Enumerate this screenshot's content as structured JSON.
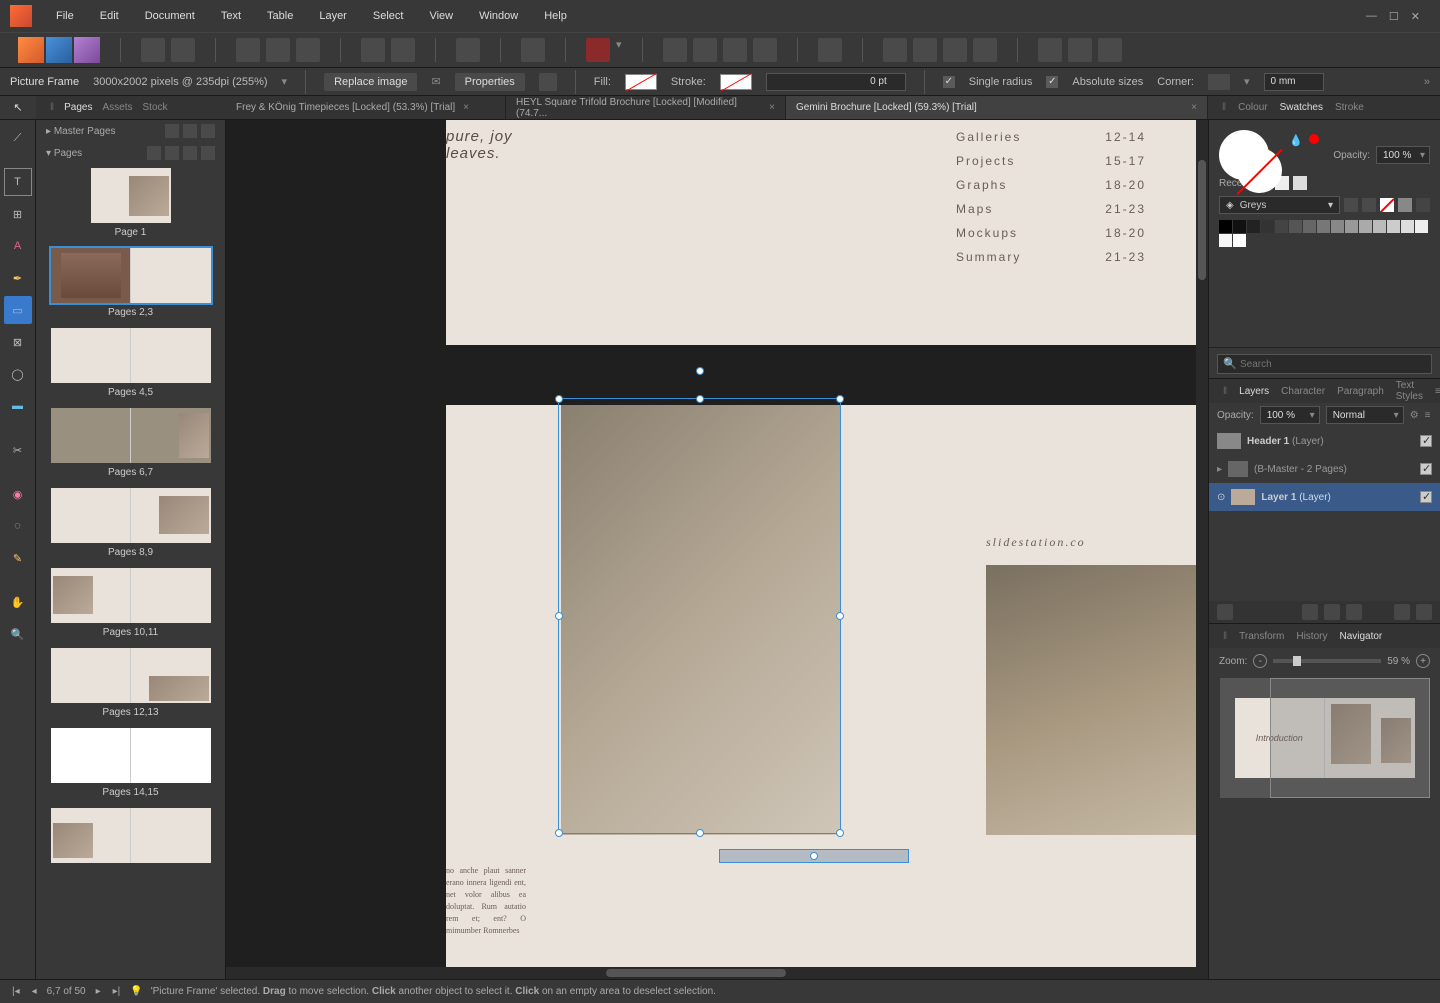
{
  "menu": {
    "items": [
      "File",
      "Edit",
      "Document",
      "Text",
      "Table",
      "Layer",
      "Select",
      "View",
      "Window",
      "Help"
    ]
  },
  "context": {
    "tool": "Picture Frame",
    "dims": "3000x2002 pixels @ 235dpi (255%)",
    "replace": "Replace image",
    "properties": "Properties",
    "fill": "Fill:",
    "stroke": "Stroke:",
    "stroke_val": "0 pt",
    "single_radius": "Single radius",
    "absolute_sizes": "Absolute sizes",
    "corner": "Corner:",
    "corner_val": "0 mm"
  },
  "doc_tabs": [
    {
      "label": "Frey & KÖnig Timepieces [Locked] (53.3%) [Trial]",
      "active": false
    },
    {
      "label": "HEYL Square Trifold Brochure [Locked] [Modified] (74.7...",
      "active": false
    },
    {
      "label": "Gemini Brochure [Locked] (59.3%) [Trial]",
      "active": true
    }
  ],
  "pages_panel": {
    "tabs": [
      "Pages",
      "Assets",
      "Stock"
    ],
    "master": "Master Pages",
    "pages": "Pages",
    "thumbs": [
      {
        "label": "Page 1",
        "single": true,
        "selected": false
      },
      {
        "label": "Pages 2,3",
        "selected": true
      },
      {
        "label": "Pages 4,5"
      },
      {
        "label": "Pages 6,7"
      },
      {
        "label": "Pages 8,9"
      },
      {
        "label": "Pages 10,11"
      },
      {
        "label": "Pages 12,13"
      },
      {
        "label": "Pages 14,15"
      }
    ]
  },
  "right": {
    "color_tabs": [
      "Colour",
      "Swatches",
      "Stroke"
    ],
    "opacity_label": "Opacity:",
    "opacity_val": "100 %",
    "recent": "Recent:",
    "greys": "Greys",
    "search_ph": "Search",
    "layer_tabs": [
      "Layers",
      "Character",
      "Paragraph",
      "Text Styles"
    ],
    "layer_opacity": "Opacity:",
    "layer_opacity_val": "100 %",
    "blend": "Normal",
    "layers": [
      {
        "name": "Header 1",
        "type": "(Layer)"
      },
      {
        "name": "(B-Master - 2 Pages)",
        "type": ""
      },
      {
        "name": "Layer 1",
        "type": "(Layer)",
        "selected": true
      }
    ],
    "nav_tabs": [
      "Transform",
      "History",
      "Navigator"
    ],
    "zoom_label": "Zoom:",
    "zoom_val": "59 %",
    "nav_intro": "Introduction"
  },
  "canvas": {
    "italic_line1": "pure, joy",
    "italic_line2": "leaves.",
    "toc": [
      {
        "k": "Galleries",
        "v": "12-14"
      },
      {
        "k": "Projects",
        "v": "15-17"
      },
      {
        "k": "Graphs",
        "v": "18-20"
      },
      {
        "k": "Maps",
        "v": "21-23"
      },
      {
        "k": "Mockups",
        "v": "18-20"
      },
      {
        "k": "Summary",
        "v": "21-23"
      }
    ],
    "slidestation": "slidestation.co",
    "body": "no anche plaut sanner erano innera ligendi ent, net volor alibus ea doluptat. Rum autatio rem et; ent? O mimumber Romnerbes"
  },
  "status": {
    "page": "6,7 of 50",
    "hint_1": "'Picture Frame' selected. ",
    "hint_drag": "Drag",
    "hint_2": " to move selection. ",
    "hint_click": "Click",
    "hint_3": " another object to select it. ",
    "hint_click2": "Click",
    "hint_4": " on an empty area to deselect selection."
  }
}
